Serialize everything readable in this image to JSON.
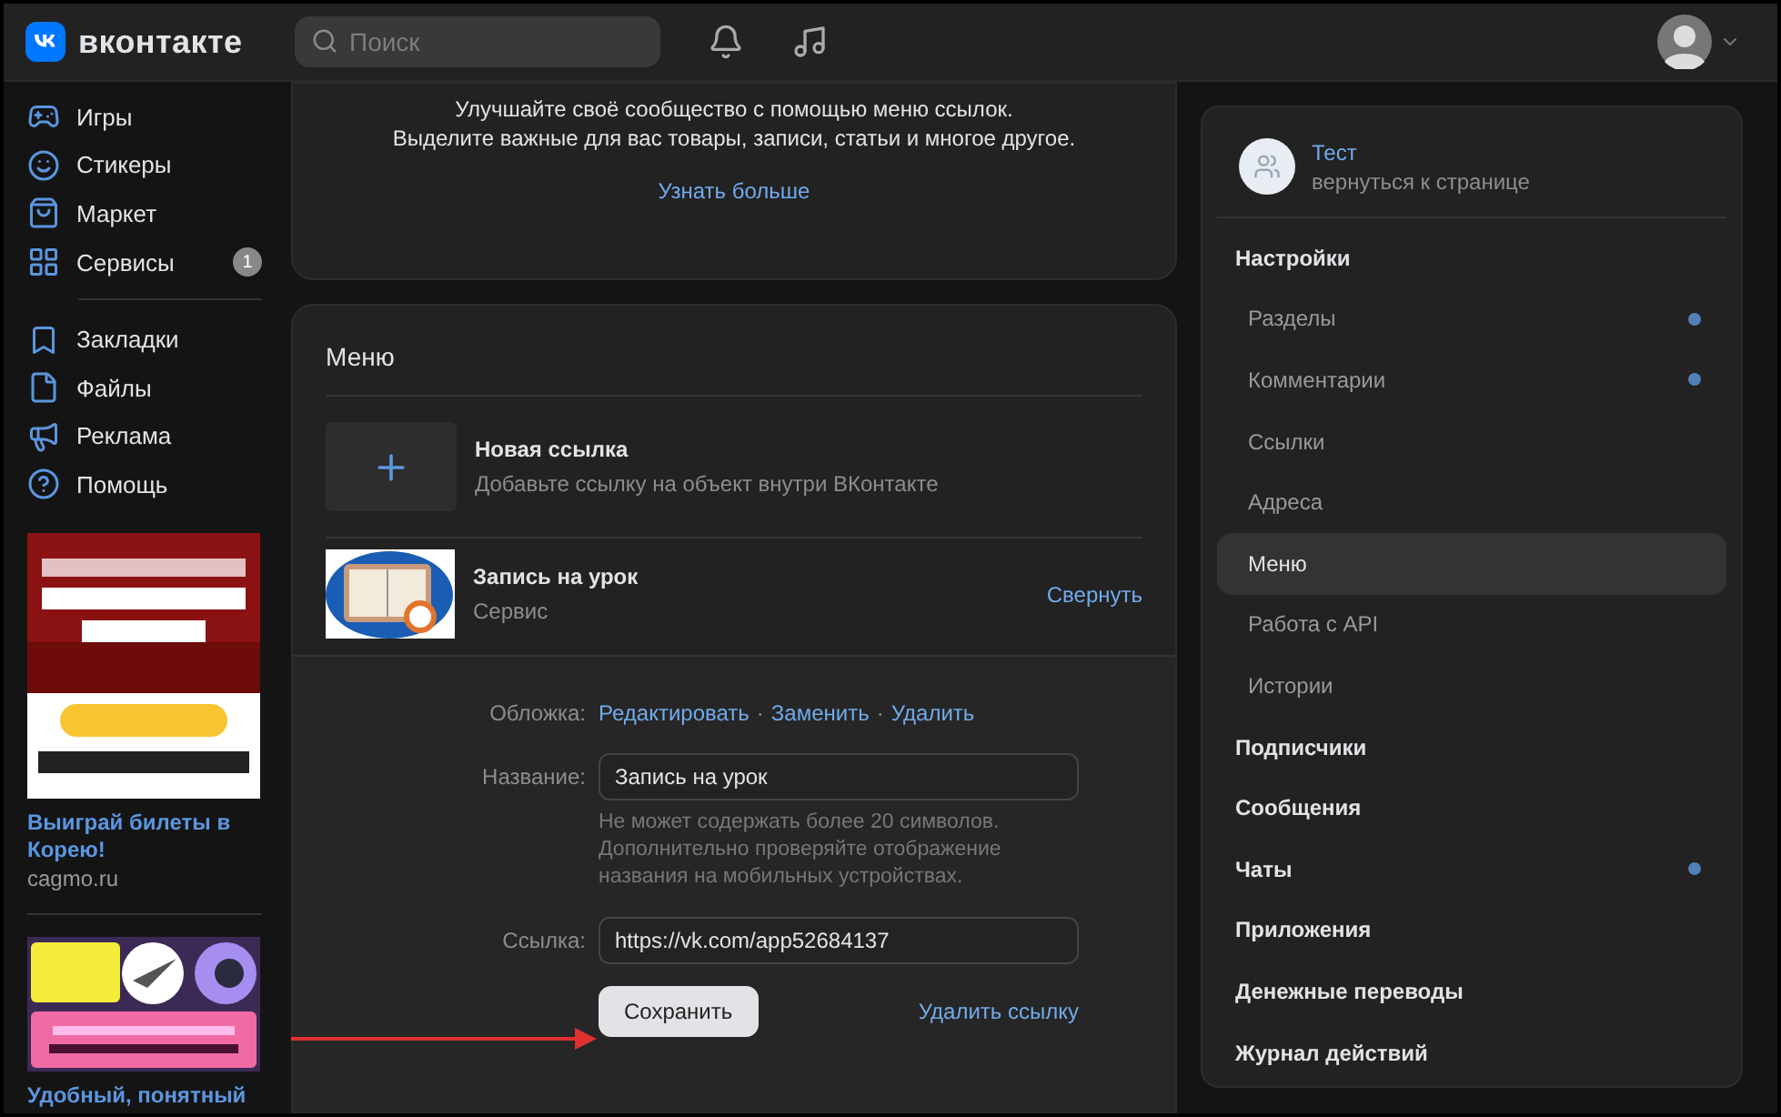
{
  "header": {
    "logo": "вконтакте",
    "search": {
      "placeholder": "Поиск"
    }
  },
  "sidebar": {
    "items": [
      {
        "label": "Игры"
      },
      {
        "label": "Стикеры"
      },
      {
        "label": "Маркет"
      },
      {
        "label": "Сервисы",
        "badge": "1"
      },
      {
        "label": "Закладки",
        "group_start": true
      },
      {
        "label": "Файлы"
      },
      {
        "label": "Реклама"
      },
      {
        "label": "Помощь"
      }
    ],
    "ads": [
      {
        "title": "Выиграй билеты в Корею!",
        "source": "cagmo.ru"
      },
      {
        "title": "Удобный, понятный"
      }
    ]
  },
  "promo": {
    "lines": [
      "Улучшайте своё сообщество с помощью меню ссылок.",
      "Выделите важные для вас товары, записи, статьи и многое другое."
    ],
    "link": "Узнать больше"
  },
  "menu": {
    "title": "Меню",
    "new_link": {
      "title": "Новая ссылка",
      "subtitle": "Добавьте ссылку на объект внутри ВКонтакте"
    },
    "link": {
      "title": "Запись на урок",
      "subtitle": "Сервис",
      "action": "Свернуть",
      "expanded": true
    },
    "form": {
      "cover_label": "Обложка:",
      "cover_actions": [
        "Редактировать",
        "Заменить",
        "Удалить"
      ],
      "action_separator": "·",
      "name_label": "Название:",
      "name_value": "Запись на урок",
      "hint": "Не может содержать более 20 символов. Дополнительно проверяйте отображение названия на мобильных устройствах.",
      "url_label": "Ссылка:",
      "url_value": "https://vk.com/app52684137",
      "save": "Сохранить",
      "delete": "Удалить ссылку"
    }
  },
  "community": {
    "name": "Тест",
    "subtitle": "вернуться к странице"
  },
  "nav": [
    {
      "label": "Настройки",
      "kind": "section",
      "selected": false,
      "dot": false
    },
    {
      "label": "Разделы",
      "kind": "sub",
      "selected": false,
      "dot": true
    },
    {
      "label": "Комментарии",
      "kind": "sub",
      "selected": false,
      "dot": true
    },
    {
      "label": "Ссылки",
      "kind": "sub",
      "selected": false,
      "dot": false
    },
    {
      "label": "Адреса",
      "kind": "sub",
      "selected": false,
      "dot": false
    },
    {
      "label": "Меню",
      "kind": "sub",
      "selected": true,
      "dot": false
    },
    {
      "label": "Работа с API",
      "kind": "sub",
      "selected": false,
      "dot": false
    },
    {
      "label": "Истории",
      "kind": "sub",
      "selected": false,
      "dot": false
    },
    {
      "label": "Подписчики",
      "kind": "section",
      "selected": false,
      "dot": false
    },
    {
      "label": "Сообщения",
      "kind": "section",
      "selected": false,
      "dot": false
    },
    {
      "label": "Чаты",
      "kind": "section",
      "selected": false,
      "dot": true
    },
    {
      "label": "Приложения",
      "kind": "section",
      "selected": false,
      "dot": false
    },
    {
      "label": "Денежные переводы",
      "kind": "section",
      "selected": false,
      "dot": false
    },
    {
      "label": "Журнал действий",
      "kind": "section",
      "selected": false,
      "dot": false
    }
  ]
}
